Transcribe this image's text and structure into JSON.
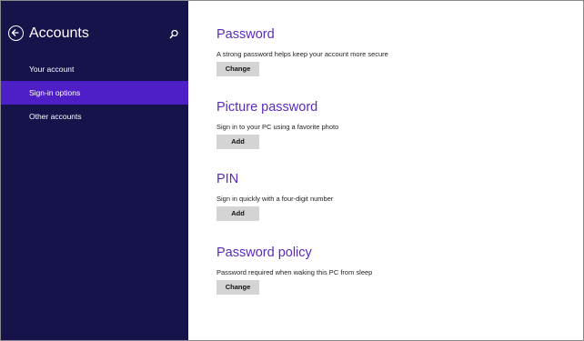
{
  "sidebar": {
    "title": "Accounts",
    "items": [
      {
        "label": "Your account",
        "selected": false
      },
      {
        "label": "Sign-in options",
        "selected": true
      },
      {
        "label": "Other accounts",
        "selected": false
      }
    ]
  },
  "sections": {
    "password": {
      "heading": "Password",
      "description": "A strong password helps keep your account more secure",
      "button": "Change"
    },
    "picture_password": {
      "heading": "Picture password",
      "description": "Sign in to your PC using a favorite photo",
      "button": "Add"
    },
    "pin": {
      "heading": "PIN",
      "description": "Sign in quickly with a four-digit number",
      "button": "Add"
    },
    "password_policy": {
      "heading": "Password policy",
      "description": "Password required when waking this PC from sleep",
      "button": "Change"
    }
  },
  "colors": {
    "sidebar_bg": "#16124a",
    "selected_bg": "#4e1fc7",
    "heading": "#5a2bbf",
    "button_bg": "#d4d4d4"
  },
  "icons": {
    "back": "back-arrow-circle-icon",
    "search": "search-icon"
  }
}
